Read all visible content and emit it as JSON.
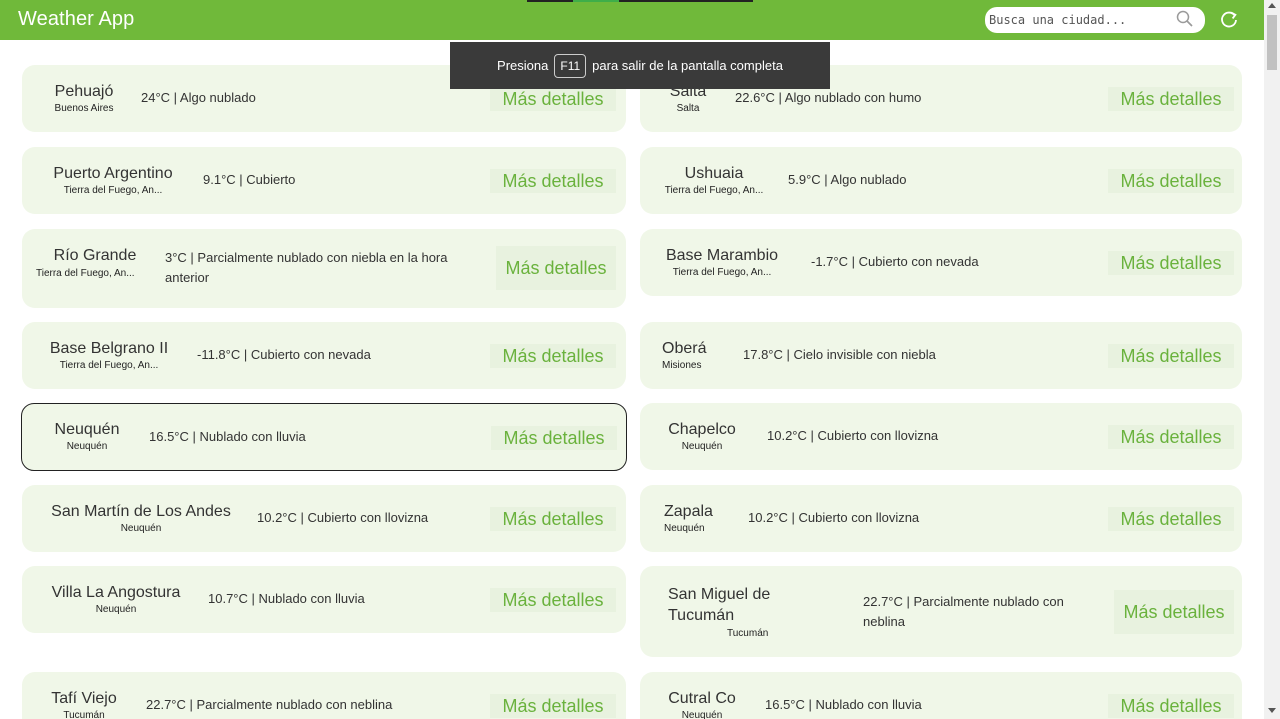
{
  "app": {
    "title": "Weather App"
  },
  "search": {
    "placeholder": "Busca una ciudad...",
    "value": ""
  },
  "toast": {
    "before": "Presiona",
    "key": "F11",
    "after": "para salir de la pantalla completa"
  },
  "details_label": "Más detalles",
  "cards": [
    {
      "city": "Pehuajó",
      "region": "Buenos Aires",
      "weather": "24°C | Algo nublado"
    },
    {
      "city": "Salta",
      "region": "Salta",
      "weather": "22.6°C | Algo nublado con humo"
    },
    {
      "city": "Puerto Argentino",
      "region": "Tierra del Fuego, An...",
      "weather": "9.1°C | Cubierto"
    },
    {
      "city": "Ushuaia",
      "region": "Tierra del Fuego, An...",
      "weather": "5.9°C | Algo nublado"
    },
    {
      "city": "Río Grande",
      "region": "Tierra del Fuego, An...",
      "weather": "3°C | Parcialmente nublado con niebla en la hora anterior"
    },
    {
      "city": "Base Marambio",
      "region": "Tierra del Fuego, An...",
      "weather": "-1.7°C | Cubierto con nevada"
    },
    {
      "city": "Base Belgrano II",
      "region": "Tierra del Fuego, An...",
      "weather": "-11.8°C | Cubierto con nevada"
    },
    {
      "city": "Oberá",
      "region": "Misiones",
      "weather": "17.8°C | Cielo invisible con niebla"
    },
    {
      "city": "Neuquén",
      "region": "Neuquén",
      "weather": "16.5°C | Nublado con lluvia"
    },
    {
      "city": "Chapelco",
      "region": "Neuquén",
      "weather": "10.2°C | Cubierto con llovizna"
    },
    {
      "city": "San Martín de Los Andes",
      "region": "Neuquén",
      "weather": "10.2°C | Cubierto con llovizna"
    },
    {
      "city": "Zapala",
      "region": "Neuquén",
      "weather": "10.2°C | Cubierto con llovizna"
    },
    {
      "city": "Villa La Angostura",
      "region": "Neuquén",
      "weather": "10.7°C | Nublado con lluvia"
    },
    {
      "city": "San Miguel de Tucumán",
      "region": "Tucumán",
      "weather": "22.7°C | Parcialmente nublado con neblina"
    },
    {
      "city": "Tafí Viejo",
      "region": "Tucumán",
      "weather": "22.7°C | Parcialmente nublado con neblina"
    },
    {
      "city": "Cutral Co",
      "region": "Neuquén",
      "weather": "16.5°C | Nublado con lluvia"
    }
  ]
}
